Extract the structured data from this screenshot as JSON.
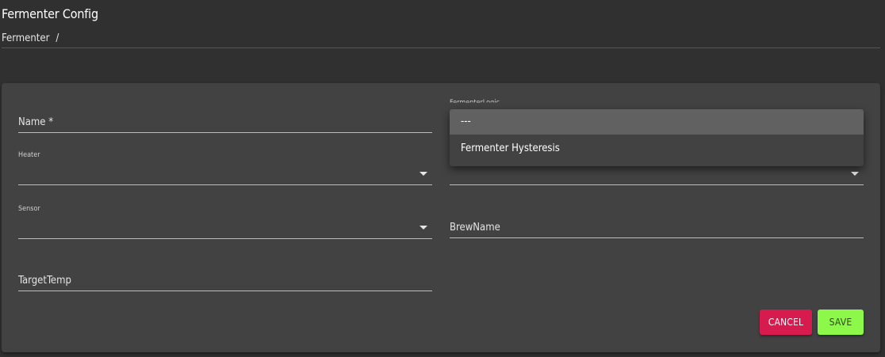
{
  "header": {
    "title": "Fermenter Config",
    "breadcrumb": [
      "Fermenter",
      "/"
    ]
  },
  "form": {
    "name": {
      "placeholder": "Name *"
    },
    "fermenter_logic": {
      "label": "FermenterLogic",
      "value": ""
    },
    "heater": {
      "label": "Heater",
      "value": ""
    },
    "cooler": {
      "value": ""
    },
    "sensor": {
      "label": "Sensor",
      "value": ""
    },
    "brew_name": {
      "placeholder": "BrewName"
    },
    "target_temp": {
      "placeholder": "TargetTemp"
    }
  },
  "dropdown": {
    "options": [
      "---",
      "Fermenter Hysteresis"
    ],
    "selected_index": 0
  },
  "actions": {
    "cancel_label": "CANCEL",
    "save_label": "SAVE"
  },
  "colors": {
    "background": "#303030",
    "card": "#424242",
    "cancel": "#d81b4f",
    "save": "#8bf84a",
    "dropdown_selected": "#616161"
  }
}
